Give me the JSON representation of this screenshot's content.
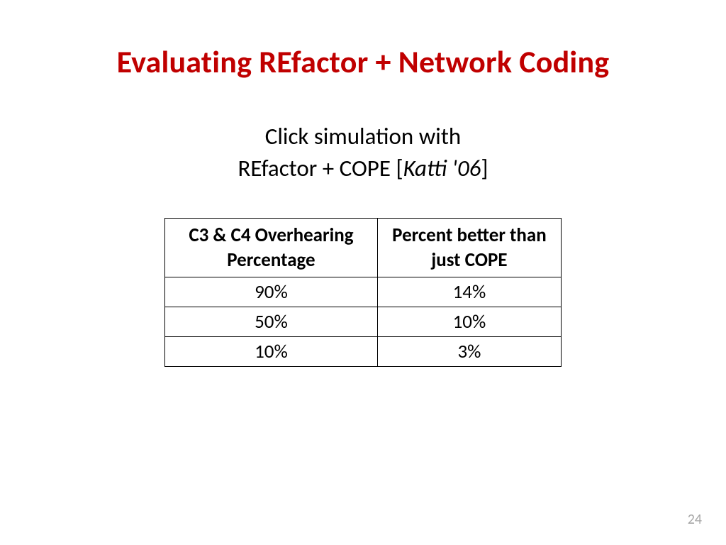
{
  "title": "Evaluating REfactor + Network Coding",
  "subtitle": {
    "line1": "Click simulation with",
    "line2_prefix": "REfactor + COPE ",
    "bracket_open": "[",
    "citation": "Katti '06",
    "bracket_close": "]"
  },
  "chart_data": {
    "type": "table",
    "headers": {
      "col1": "C3 & C4 Overhearing Percentage",
      "col2": "Percent better than just COPE"
    },
    "rows": [
      {
        "overhearing": "90%",
        "better": "14%"
      },
      {
        "overhearing": "50%",
        "better": "10%"
      },
      {
        "overhearing": "10%",
        "better": "3%"
      }
    ]
  },
  "page_number": "24"
}
